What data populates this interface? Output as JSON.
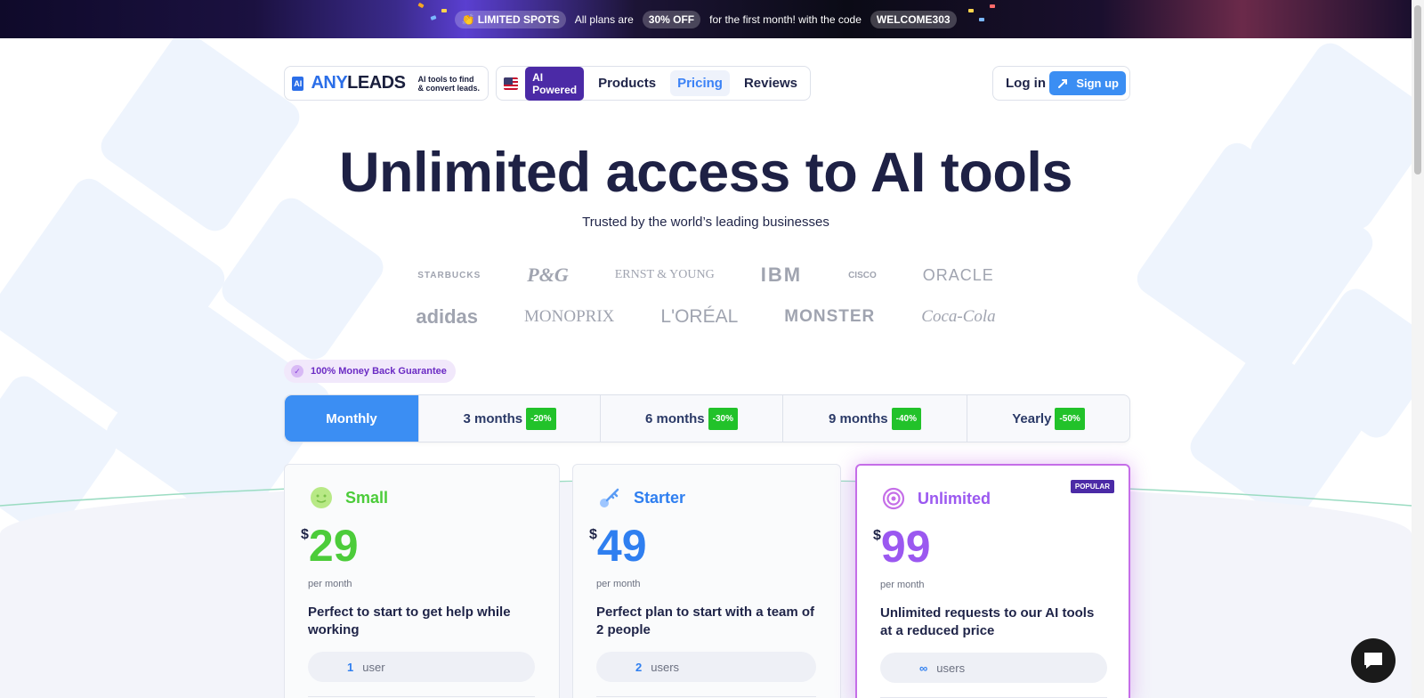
{
  "promo": {
    "limited_label": "👏 LIMITED SPOTS",
    "text1": "All plans are",
    "discount": "30% OFF",
    "text2": "for the first month! with the code",
    "code": "WELCOME303"
  },
  "brand": {
    "logo_mark": "AI",
    "name_part1": "ANY",
    "name_part2": "LEADS",
    "tagline": "AI tools to find & convert leads."
  },
  "nav": {
    "badge": "AI Powered",
    "links": [
      "Products",
      "Pricing",
      "Reviews"
    ],
    "active": "Pricing",
    "login": "Log in",
    "signup": "Sign up"
  },
  "hero": {
    "title": "Unlimited access to AI tools",
    "subtitle": "Trusted by the world’s leading businesses"
  },
  "client_logos": {
    "row1": [
      "STARBUCKS",
      "P&G",
      "ERNST & YOUNG",
      "IBM",
      "CISCO",
      "ORACLE"
    ],
    "row2": [
      "adidas",
      "MONOPRIX",
      "L'ORÉAL",
      "MONSTER",
      "Coca-Cola"
    ]
  },
  "guarantee": "100% Money Back Guarantee",
  "periods": [
    {
      "label": "Monthly",
      "discount": ""
    },
    {
      "label": "3 months",
      "discount": "-20%"
    },
    {
      "label": "6 months",
      "discount": "-30%"
    },
    {
      "label": "9 months",
      "discount": "-40%"
    },
    {
      "label": "Yearly",
      "discount": "-50%"
    }
  ],
  "plans": [
    {
      "name": "Small",
      "currency": "$",
      "price": "29",
      "period": "per month",
      "description": "Perfect to start to get help while working",
      "users_count": "1",
      "users_label": "user",
      "color": "#4ccc3a"
    },
    {
      "name": "Starter",
      "currency": "$",
      "price": "49",
      "period": "per month",
      "description": "Perfect plan to start with a team of 2 people",
      "users_count": "2",
      "users_label": "users",
      "color": "#2f7ff0"
    },
    {
      "name": "Unlimited",
      "currency": "$",
      "price": "99",
      "period": "per month",
      "description": "Unlimited requests to our AI tools at a reduced price",
      "users_count": "∞",
      "users_label": "users",
      "color": "#9b58f0",
      "badge": "POPULAR"
    }
  ],
  "colors": {
    "accent": "#3b8ef3",
    "purple": "#4b2aa6",
    "green_discount": "#22c22a",
    "popular_border": "#c56ee8"
  }
}
